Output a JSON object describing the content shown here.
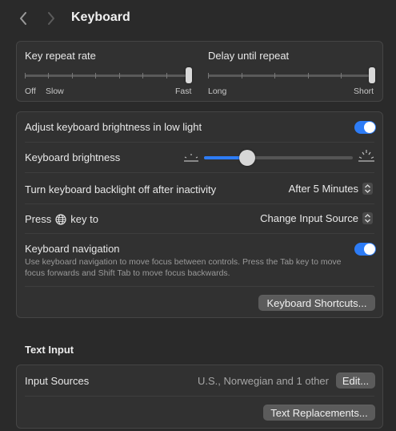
{
  "header": {
    "title": "Keyboard"
  },
  "repeat": {
    "key_repeat_label": "Key repeat rate",
    "key_repeat_ticks": [
      "Off",
      "Slow",
      "Fast"
    ],
    "key_repeat_value": 1.0,
    "delay_label": "Delay until repeat",
    "delay_ticks": [
      "Long",
      "Short"
    ],
    "delay_value": 1.0
  },
  "backlight": {
    "adjust_label": "Adjust keyboard brightness in low light",
    "adjust_on": true,
    "brightness_label": "Keyboard brightness",
    "brightness_value": 0.29,
    "inactivity_label": "Turn keyboard backlight off after inactivity",
    "inactivity_value": "After 5 Minutes",
    "press_label_prefix": "Press",
    "press_label_suffix": "key to",
    "press_value": "Change Input Source",
    "nav_label": "Keyboard navigation",
    "nav_desc": "Use keyboard navigation to move focus between controls. Press the Tab key to move focus forwards and Shift Tab to move focus backwards.",
    "nav_on": true,
    "shortcuts_button": "Keyboard Shortcuts..."
  },
  "text_input": {
    "section_title": "Text Input",
    "input_sources_label": "Input Sources",
    "input_sources_value": "U.S., Norwegian and 1 other",
    "edit_button": "Edit...",
    "replacements_button": "Text Replacements..."
  },
  "colors": {
    "accent": "#2d7cf6",
    "background": "#2a2a2a",
    "panel": "#313131"
  },
  "icons": [
    "chevron-left-icon",
    "chevron-right-icon",
    "brightness-low-icon",
    "brightness-high-icon",
    "globe-icon",
    "stepper-icon"
  ]
}
